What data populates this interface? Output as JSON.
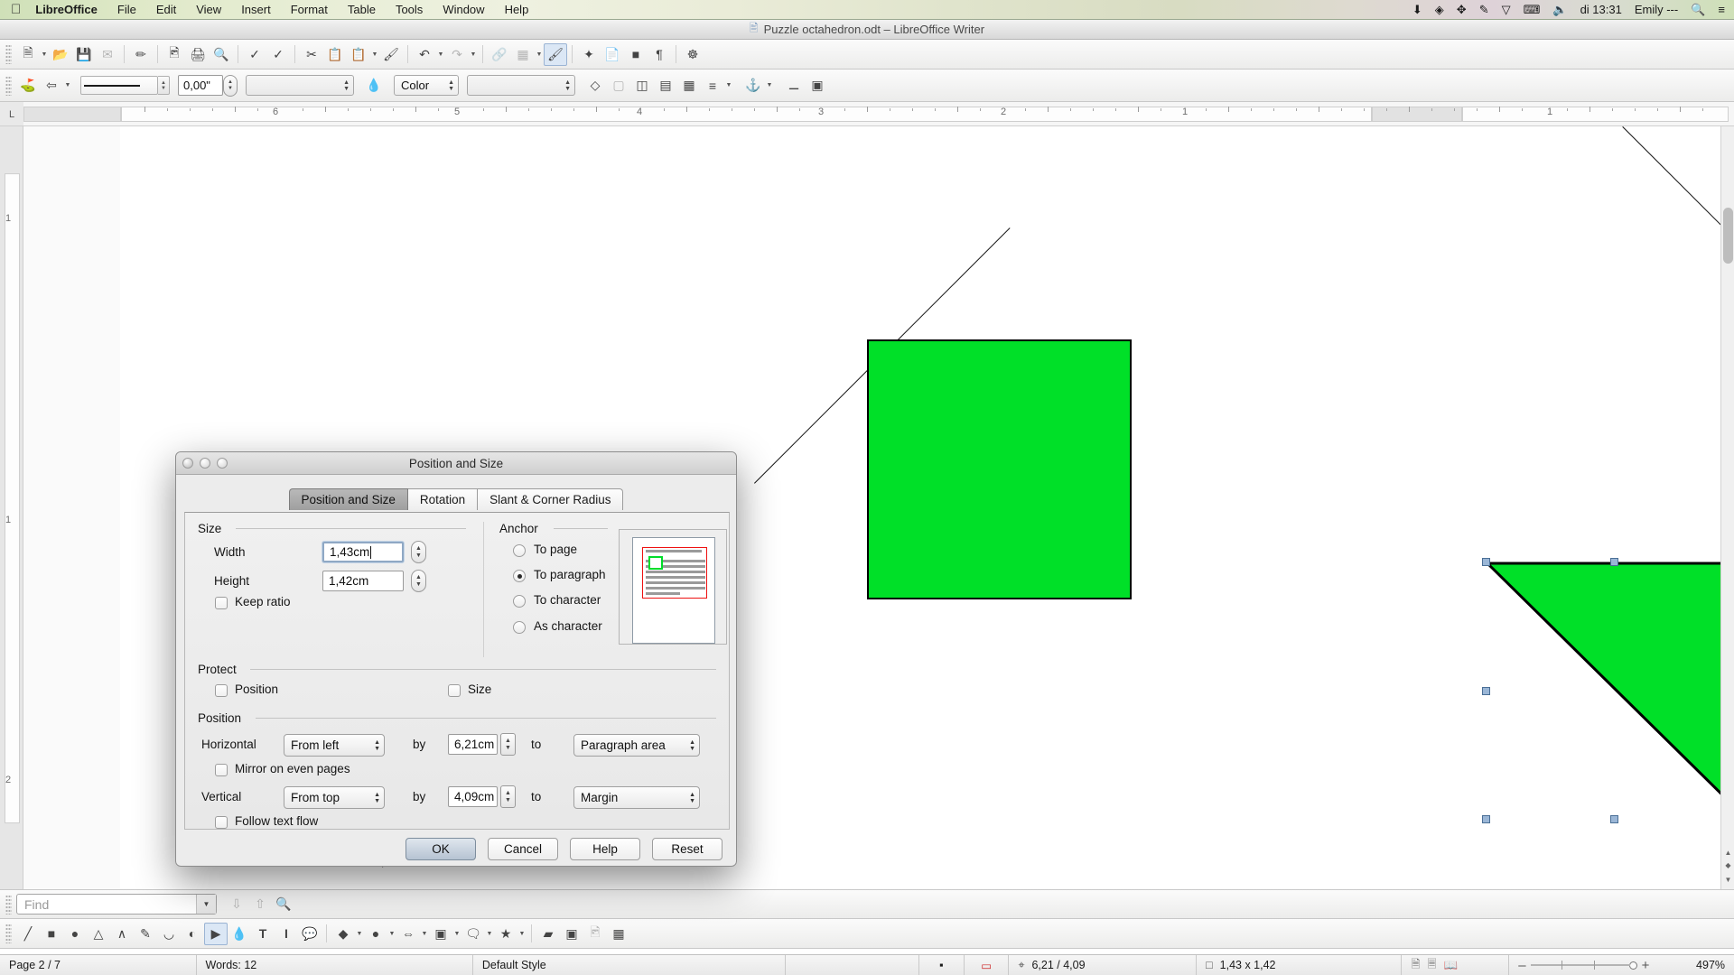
{
  "menubar": {
    "apple_icon": "apple-logo",
    "app_name": "LibreOffice",
    "items": [
      "File",
      "Edit",
      "View",
      "Insert",
      "Format",
      "Table",
      "Tools",
      "Window",
      "Help"
    ],
    "status_icons": [
      "download-icon",
      "dropbox-icon",
      "bluetooth-icon",
      "pen-icon",
      "wifi-icon",
      "timemachine-icon",
      "volume-icon"
    ],
    "clock": "di 13:31",
    "user": "Emily ---",
    "search_icon": "search-icon",
    "notification_icon": "notification-center-icon"
  },
  "titlebar": {
    "doc_icon": "document-icon",
    "title": "Puzzle octahedron.odt – LibreOffice Writer"
  },
  "toolbar_standard": {
    "icons": [
      "new-document-icon",
      "open-icon",
      "save-icon",
      "email-icon",
      "edit-mode-icon",
      "export-pdf-icon",
      "print-icon",
      "print-preview-icon",
      "spelling-icon",
      "autospellcheck-icon",
      "cut-icon",
      "copy-icon",
      "paste-icon",
      "clone-formatting-icon",
      "undo-icon",
      "redo-icon",
      "hyperlink-icon",
      "table-icon",
      "draw-functions-icon",
      "gallery-icon",
      "nonprinting-chars-icon",
      "help-icon"
    ]
  },
  "toolbar_drawing_props": {
    "line_style_label": "",
    "line_width_value": "0,00\"",
    "line_color_value": "",
    "area_style_label": "Color",
    "area_color_value": "",
    "icons": [
      "line-color-icon",
      "arrow-style-icon",
      "fill-bucket-icon",
      "shadow-icon",
      "3d-icon",
      "filter-icon"
    ]
  },
  "ruler": {
    "horizontal_ticks": [
      "6",
      "5",
      "4",
      "3",
      "2",
      "1",
      "1"
    ],
    "vertical_ticks": [
      "1",
      "1",
      "2"
    ],
    "corner_icon": "tab-stop-icon"
  },
  "document": {
    "shapes": [
      {
        "name": "green-square",
        "fill": "#00e028",
        "stroke": "#000000"
      },
      {
        "name": "green-triangle-selected",
        "fill": "#00e028",
        "stroke": "#000000",
        "selected": true
      },
      {
        "name": "black-triangle",
        "fill": "#000000"
      }
    ]
  },
  "findbar": {
    "placeholder": "Find",
    "value": "",
    "icons": [
      "find-next-icon",
      "find-previous-icon",
      "find-replace-icon"
    ]
  },
  "toolbar_draw": {
    "icons": [
      "line-icon",
      "rectangle-icon",
      "ellipse-icon",
      "polygon-icon",
      "curve-icon",
      "freeform-line-icon",
      "arc-icon",
      "pie-icon",
      "select-icon",
      "basic-shape-icon",
      "text-box-icon",
      "vertical-text-icon",
      "callout-icon",
      "symbol-shapes-icon",
      "block-arrows-icon",
      "flowchart-icon",
      "callouts-icon",
      "stars-icon",
      "points-icon",
      "fontwork-icon",
      "from-file-icon",
      "extrusion-icon"
    ],
    "selected_icon": "select-icon"
  },
  "statusbar": {
    "page": "Page 2 / 7",
    "words": "Words: 12",
    "style": "Default Style",
    "selection_mode_icon": "selection-mode-icon",
    "modified_icon": "document-modified-icon",
    "position_icon": "object-position-icon",
    "position": "6,21 / 4,09",
    "size_icon": "object-size-icon",
    "size": "1,43 x 1,42",
    "view_layout_icons": [
      "single-page-view-icon",
      "multi-page-view-icon",
      "book-view-icon"
    ],
    "zoom_out": "–",
    "zoom_in": "+",
    "zoom": "497%"
  },
  "dialog": {
    "title": "Position and Size",
    "window_buttons": [
      "close-button",
      "minimize-button",
      "zoom-button"
    ],
    "tabs": [
      {
        "label": "Position and Size",
        "active": true
      },
      {
        "label": "Rotation",
        "active": false
      },
      {
        "label": "Slant & Corner Radius",
        "active": false
      }
    ],
    "size_group": {
      "title": "Size",
      "width_label": "Width",
      "width_value": "1,43cm",
      "height_label": "Height",
      "height_value": "1,42cm",
      "keep_ratio_label": "Keep ratio",
      "keep_ratio_checked": false
    },
    "anchor_group": {
      "title": "Anchor",
      "options": [
        {
          "label": "To page",
          "selected": false
        },
        {
          "label": "To paragraph",
          "selected": true
        },
        {
          "label": "To character",
          "selected": false
        },
        {
          "label": "As character",
          "selected": false
        }
      ]
    },
    "protect_group": {
      "title": "Protect",
      "position_label": "Position",
      "position_checked": false,
      "size_label": "Size",
      "size_checked": false
    },
    "position_group": {
      "title": "Position",
      "horizontal_label": "Horizontal",
      "horizontal_mode": "From left",
      "horizontal_by_label": "by",
      "horizontal_by_value": "6,21cm",
      "horizontal_to_label": "to",
      "horizontal_to_value": "Paragraph area",
      "mirror_label": "Mirror on even pages",
      "mirror_checked": false,
      "vertical_label": "Vertical",
      "vertical_mode": "From top",
      "vertical_by_label": "by",
      "vertical_by_value": "4,09cm",
      "vertical_to_label": "to",
      "vertical_to_value": "Margin",
      "follow_label": "Follow text flow",
      "follow_checked": false
    },
    "buttons": {
      "ok": "OK",
      "cancel": "Cancel",
      "help": "Help",
      "reset": "Reset"
    }
  }
}
